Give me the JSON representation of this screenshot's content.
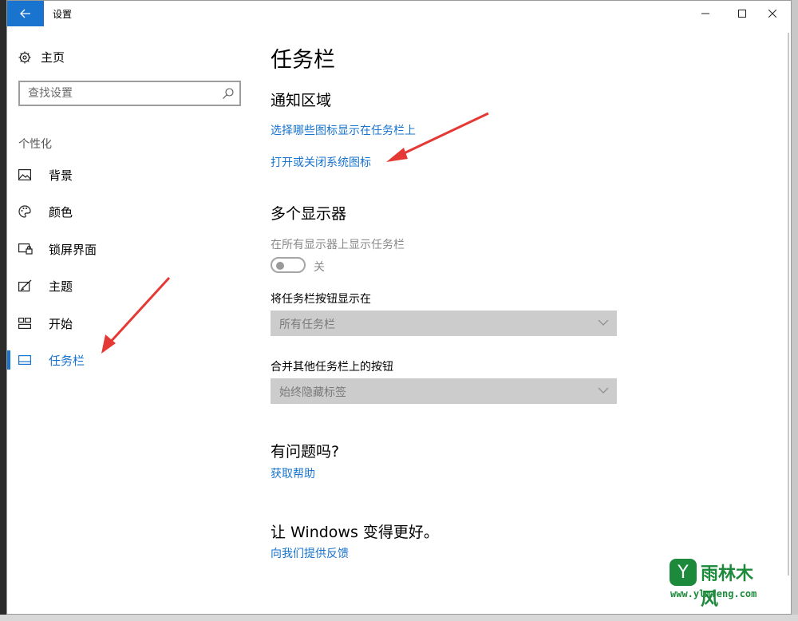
{
  "window": {
    "title": "设置"
  },
  "sidebar": {
    "home_label": "主页",
    "search_placeholder": "查找设置",
    "section_label": "个性化",
    "items": [
      {
        "label": "背景",
        "icon": "picture-icon"
      },
      {
        "label": "颜色",
        "icon": "palette-icon"
      },
      {
        "label": "锁屏界面",
        "icon": "lock-screen-icon"
      },
      {
        "label": "主题",
        "icon": "theme-icon"
      },
      {
        "label": "开始",
        "icon": "start-icon"
      },
      {
        "label": "任务栏",
        "icon": "taskbar-icon",
        "active": true
      }
    ]
  },
  "main": {
    "title": "任务栏",
    "notification_area": {
      "heading": "通知区域",
      "link1": "选择哪些图标显示在任务栏上",
      "link2": "打开或关闭系统图标"
    },
    "multi_display": {
      "heading": "多个显示器",
      "show_on_all_label": "在所有显示器上显示任务栏",
      "toggle_state": "关",
      "show_buttons_label": "将任务栏按钮显示在",
      "show_buttons_value": "所有任务栏",
      "combine_label": "合并其他任务栏上的按钮",
      "combine_value": "始终隐藏标签"
    },
    "help": {
      "heading": "有问题吗?",
      "link": "获取帮助"
    },
    "feedback": {
      "heading": "让 Windows 变得更好。",
      "link": "向我们提供反馈"
    }
  },
  "watermark": {
    "logo_char": "Y",
    "brand": "雨林木风",
    "url": "www.ylmfeng.com"
  },
  "colors": {
    "accent": "#1874cf",
    "arrow": "#e53935",
    "watermark": "#1c8a3a"
  }
}
